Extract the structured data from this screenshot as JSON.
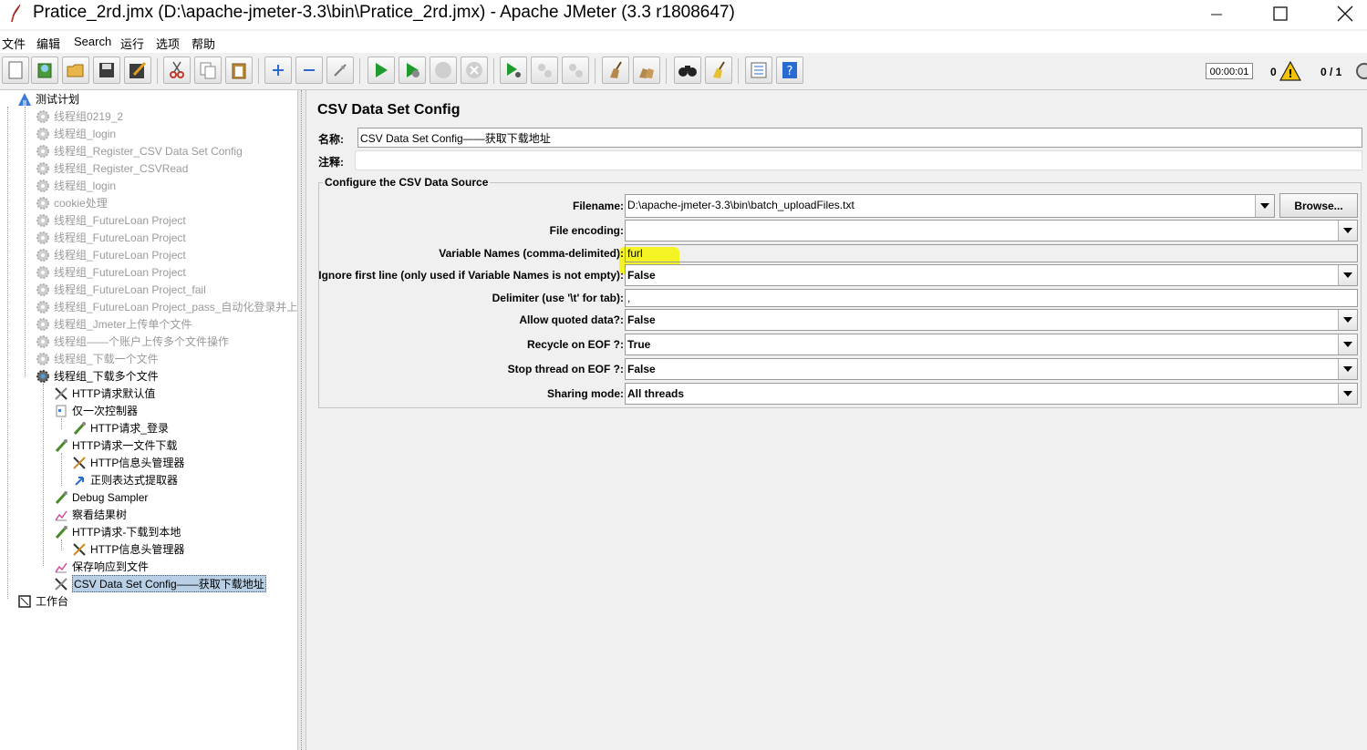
{
  "window": {
    "title": "Pratice_2rd.jmx (D:\\apache-jmeter-3.3\\bin\\Pratice_2rd.jmx) - Apache JMeter (3.3 r1808647)"
  },
  "menu": [
    "文件",
    "编辑",
    "Search",
    "运行",
    "选项",
    "帮助"
  ],
  "status": {
    "timer": "00:00:01",
    "warnings": "0",
    "threads": "0 / 1"
  },
  "tree": {
    "root": "测试计划",
    "items": [
      {
        "label": "线程组0219_2"
      },
      {
        "label": "线程组_login"
      },
      {
        "label": "线程组_Register_CSV Data Set Config"
      },
      {
        "label": "线程组_Register_CSVRead"
      },
      {
        "label": "线程组_login"
      },
      {
        "label": "cookie处理"
      },
      {
        "label": "线程组_FutureLoan Project"
      },
      {
        "label": "线程组_FutureLoan Project"
      },
      {
        "label": "线程组_FutureLoan Project"
      },
      {
        "label": "线程组_FutureLoan Project"
      },
      {
        "label": "线程组_FutureLoan Project_fail"
      },
      {
        "label": "线程组_FutureLoan Project_pass_自动化登录并上"
      },
      {
        "label": "线程组_Jmeter上传单个文件"
      },
      {
        "label": "线程组——个账户上传多个文件操作"
      },
      {
        "label": "线程组_下载一个文件"
      },
      {
        "label": "线程组_下载多个文件"
      },
      {
        "label": "HTTP请求默认值"
      },
      {
        "label": "仅一次控制器"
      },
      {
        "label": "HTTP请求_登录"
      },
      {
        "label": "HTTP请求一文件下载"
      },
      {
        "label": "HTTP信息头管理器"
      },
      {
        "label": "正则表达式提取器"
      },
      {
        "label": "Debug Sampler"
      },
      {
        "label": "察看结果树"
      },
      {
        "label": "HTTP请求-下载到本地"
      },
      {
        "label": "HTTP信息头管理器"
      },
      {
        "label": "保存响应到文件"
      },
      {
        "label": "CSV Data Set Config——获取下载地址"
      }
    ],
    "workbench": "工作台"
  },
  "panel": {
    "title": "CSV Data Set Config",
    "name_label": "名称:",
    "name_value": "CSV Data Set Config——获取下载地址",
    "comment_label": "注释:",
    "comment_value": "",
    "group_title": "Configure the CSV Data Source",
    "filename_label": "Filename:",
    "filename_value": "D:\\apache-jmeter-3.3\\bin\\batch_uploadFiles.txt",
    "browse_label": "Browse...",
    "encoding_label": "File encoding:",
    "encoding_value": "",
    "varnames_label": "Variable Names (comma-delimited):",
    "varnames_value": "furl",
    "ignore_label": "Ignore first line (only used if Variable Names is not empty):",
    "ignore_value": "False",
    "delimiter_label": "Delimiter (use '\\t' for tab):",
    "delimiter_value": ",",
    "quoted_label": "Allow quoted data?:",
    "quoted_value": "False",
    "recycle_label": "Recycle on EOF ?:",
    "recycle_value": "True",
    "stop_label": "Stop thread on EOF ?:",
    "stop_value": "False",
    "sharing_label": "Sharing mode:",
    "sharing_value": "All threads"
  }
}
